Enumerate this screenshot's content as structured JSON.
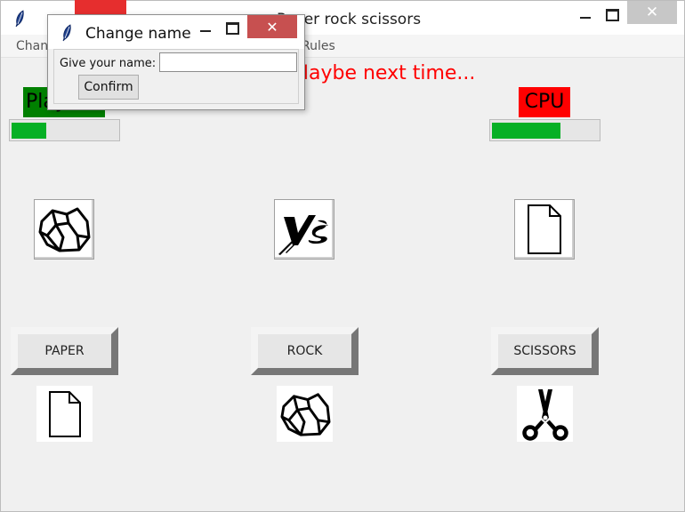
{
  "app": {
    "title": "Paper rock scissors",
    "menu": [
      "Change name",
      "Rules"
    ]
  },
  "message": "Maybe next time...",
  "scores": {
    "player_label": "Player",
    "cpu_label": "CPU",
    "player_progress": 0.33,
    "cpu_progress": 0.66,
    "player_color": "#008000",
    "cpu_color": "#ff0000",
    "progress_color": "#06b025"
  },
  "battle": {
    "player_choice_icon": "rock-icon",
    "vs_icon": "vs-icon",
    "cpu_choice_icon": "paper-icon"
  },
  "choices": [
    {
      "label": "PAPER",
      "icon": "paper-icon"
    },
    {
      "label": "ROCK",
      "icon": "rock-icon"
    },
    {
      "label": "SCISSORS",
      "icon": "scissors-icon"
    }
  ],
  "dialog": {
    "title": "Change name",
    "prompt": "Give your name:",
    "name_value": "",
    "confirm_label": "Confirm",
    "close_color": "#c75050"
  }
}
